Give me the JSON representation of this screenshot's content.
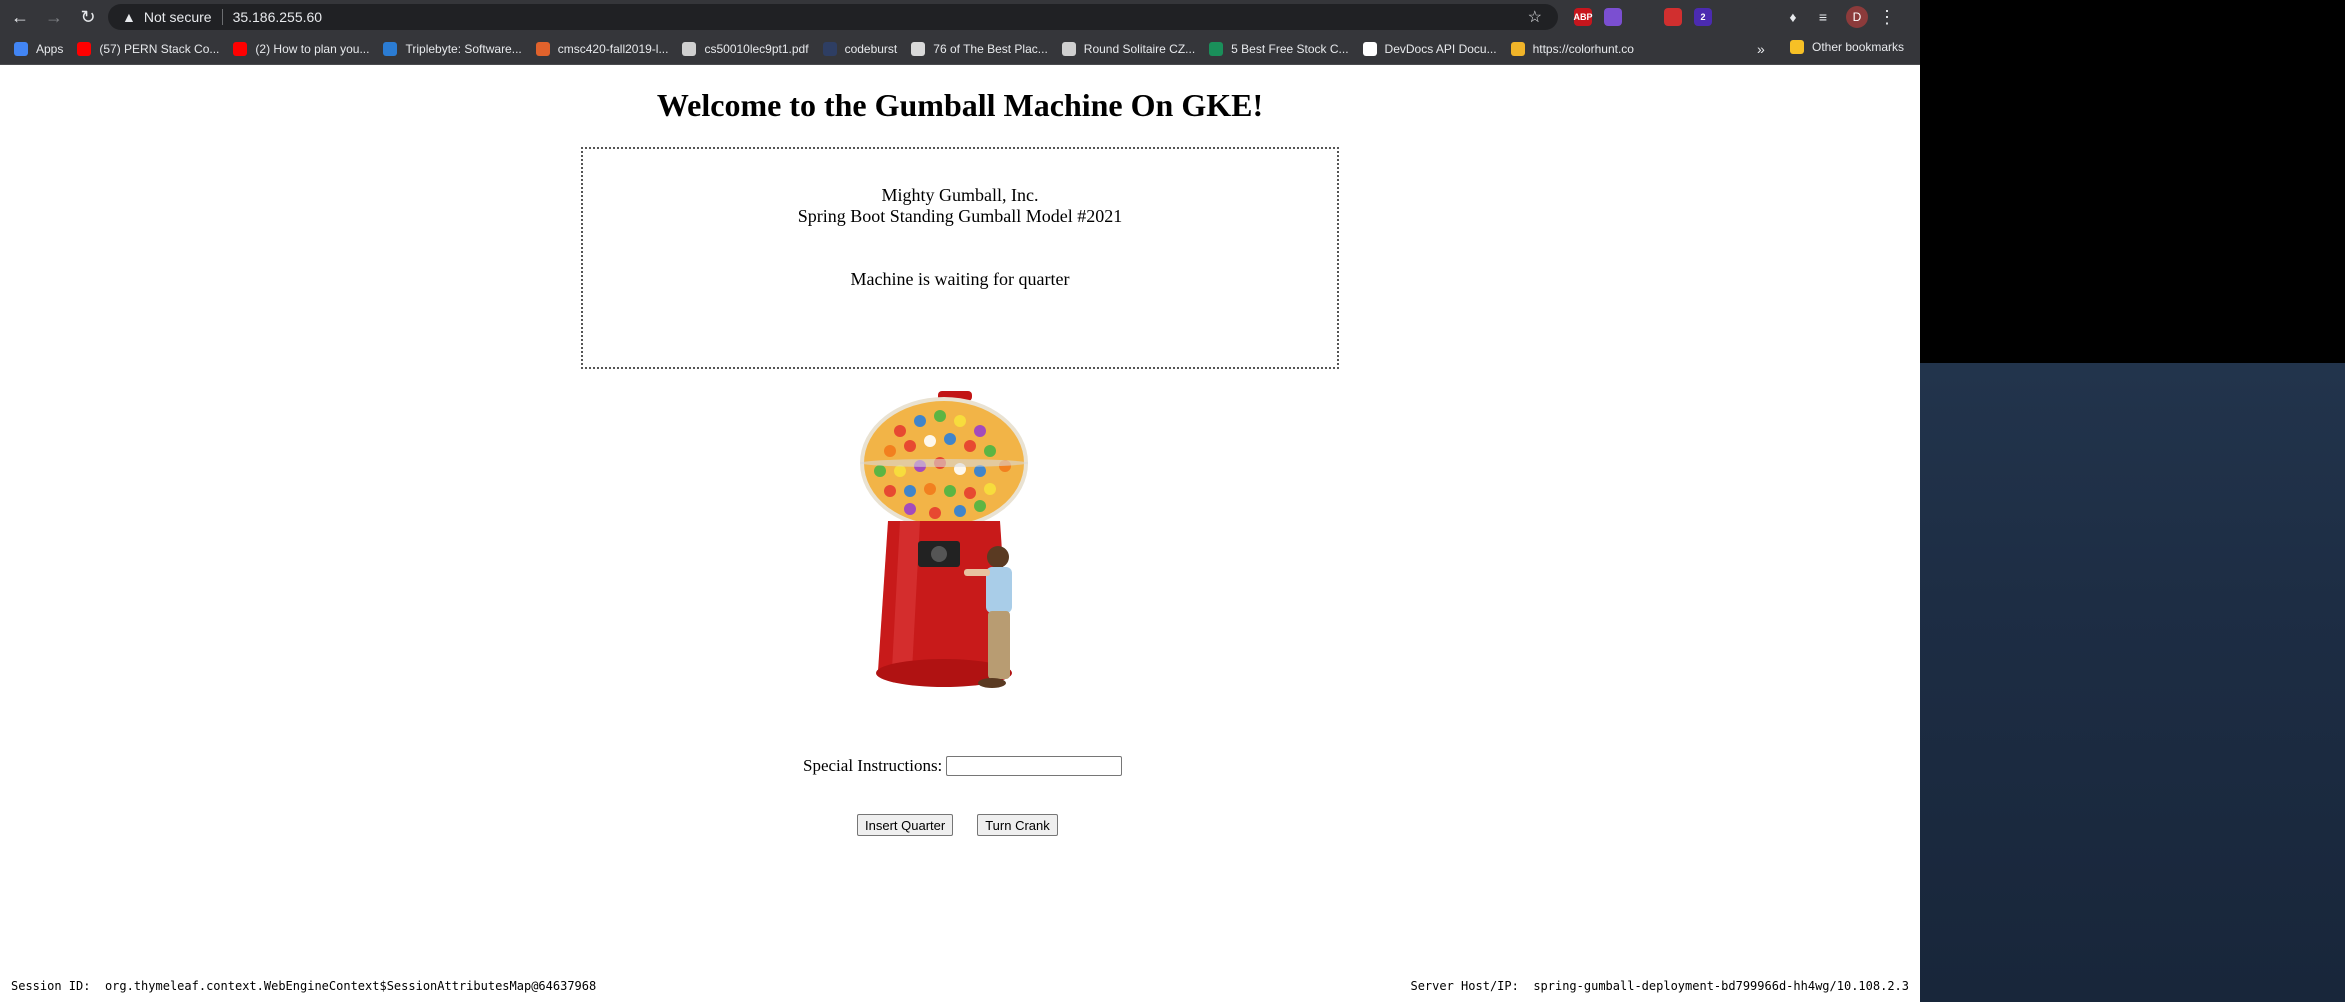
{
  "browser": {
    "security_label": "Not secure",
    "url": "35.186.255.60",
    "profile_initial": "D",
    "extensions": [
      {
        "name": "abp-icon",
        "label": "ABP",
        "color": "#c7161d"
      },
      {
        "name": "feather-icon",
        "label": "",
        "color": "#7b4fd1"
      },
      {
        "name": "react-icon",
        "label": "",
        "color": "#35363a"
      },
      {
        "name": "youtube-ext-icon",
        "label": "",
        "color": "#d12f2f"
      },
      {
        "name": "badge-ext-icon",
        "label": "2",
        "color": "#4b2bb0"
      },
      {
        "name": "diamond-icon",
        "label": "",
        "color": "#35363a"
      },
      {
        "name": "bulb-icon",
        "label": "",
        "color": "#35363a"
      }
    ]
  },
  "bookmarks": {
    "items": [
      {
        "label": "Apps",
        "color": "#4285f4"
      },
      {
        "label": "(57) PERN Stack Co...",
        "color": "#ff0000"
      },
      {
        "label": "(2) How to plan you...",
        "color": "#ff0000"
      },
      {
        "label": "Triplebyte: Software...",
        "color": "#2b7cd3"
      },
      {
        "label": "cmsc420-fall2019-l...",
        "color": "#e0622c"
      },
      {
        "label": "cs50010lec9pt1.pdf",
        "color": "#cfcfcf"
      },
      {
        "label": "codeburst",
        "color": "#2e3e63"
      },
      {
        "label": "76 of The Best Plac...",
        "color": "#d9d9d9"
      },
      {
        "label": "Round Solitaire CZ...",
        "color": "#cfcfcf"
      },
      {
        "label": "5 Best Free Stock C...",
        "color": "#1a8f5a"
      },
      {
        "label": "DevDocs API Docu...",
        "color": "#ffffff"
      },
      {
        "label": "https://colorhunt.co",
        "color": "#f0b429"
      }
    ],
    "more": "»",
    "other_label": "Other bookmarks"
  },
  "page": {
    "title": "Welcome to the Gumball Machine On GKE!",
    "company": "Mighty Gumball, Inc.",
    "model": "Spring Boot Standing Gumball Model #2021",
    "status": "Machine is waiting for quarter",
    "instructions_label": "Special Instructions:",
    "instructions_value": "",
    "insert_quarter_label": "Insert Quarter",
    "turn_crank_label": "Turn Crank",
    "session_label": "Session ID:",
    "session_value": "org.thymeleaf.context.WebEngineContext$SessionAttributesMap@64637968",
    "server_label": "Server Host/IP:",
    "server_value": "spring-gumball-deployment-bd799966d-hh4wg/10.108.2.3"
  }
}
